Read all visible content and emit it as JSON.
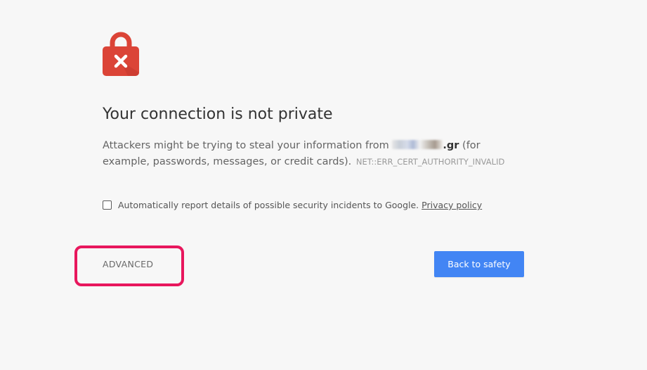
{
  "interstitial": {
    "title": "Your connection is not private",
    "message_prefix": "Attackers might be trying to steal your information from",
    "domain_suffix": ".gr",
    "message_suffix": "(for example, passwords, messages, or credit cards).",
    "error_code": "NET::ERR_CERT_AUTHORITY_INVALID"
  },
  "report": {
    "checked": false,
    "label": "Automatically report details of possible security incidents to Google.",
    "privacy_link": "Privacy policy"
  },
  "buttons": {
    "advanced": "ADVANCED",
    "back_to_safety": "Back to safety"
  },
  "icons": {
    "lock": "lock-error-icon"
  },
  "colors": {
    "background": "#f7f7f7",
    "lock_red": "#db4437",
    "primary_button": "#4285f4",
    "highlight": "#e8175d"
  }
}
